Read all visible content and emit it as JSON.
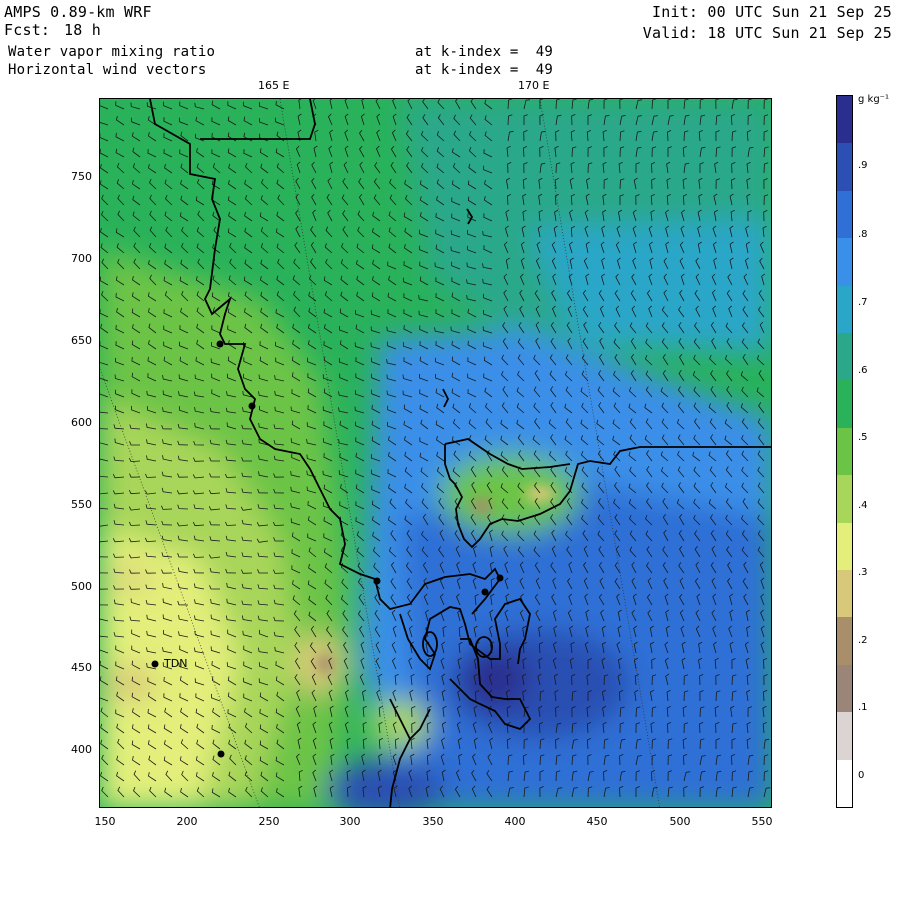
{
  "header": {
    "model": "AMPS 0.89-km WRF",
    "forecast_label": "Fcst:",
    "forecast_value": "18 h",
    "field1": "Water vapor mixing ratio",
    "field2": "Horizontal wind vectors",
    "field1_level": "at k-index =  49",
    "field2_level": "at k-index =  49",
    "init": "Init: 00 UTC Sun 21 Sep 25",
    "valid": "Valid: 18 UTC Sun 21 Sep 25"
  },
  "longitude_labels": [
    "165 E",
    "170 E"
  ],
  "y_axis_ticks": [
    "750",
    "700",
    "650",
    "600",
    "550",
    "500",
    "450",
    "400"
  ],
  "x_axis_ticks": [
    "150",
    "200",
    "250",
    "300",
    "350",
    "400",
    "450",
    "500",
    "550"
  ],
  "colorbar": {
    "units": "g kg⁻¹",
    "labels": [
      ".9",
      ".8",
      ".7",
      ".6",
      ".5",
      ".4",
      ".3",
      ".2",
      ".1",
      "0"
    ],
    "colors": [
      "#2a2f8f",
      "#2c4fb3",
      "#2f6fd6",
      "#3a8fe8",
      "#2aa6c8",
      "#2ba88a",
      "#29b25a",
      "#6cc447",
      "#a8d65a",
      "#e3ef7a",
      "#d8c879",
      "#a88e6b",
      "#9b8478",
      "#dcd4d2",
      "#ffffff"
    ]
  },
  "station": "TDN",
  "colors": {
    "dry_yellow": "#e6f07e",
    "moist_green": "#39b256",
    "wet_blue": "#2f6fd6",
    "very_wet": "#2a2f8f",
    "coastline": "#000000"
  }
}
